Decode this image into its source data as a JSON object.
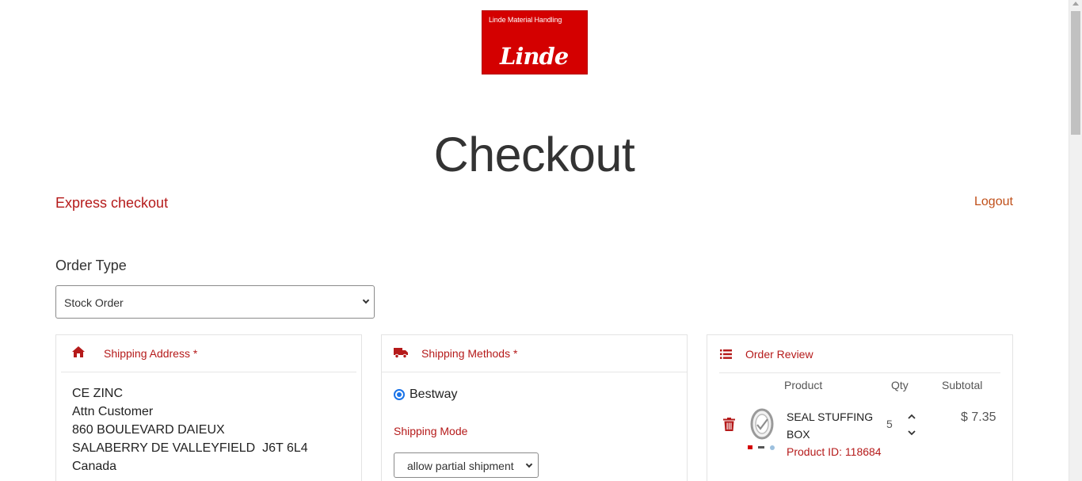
{
  "logo": {
    "top_text": "Linde Material Handling",
    "script_text": "Linde"
  },
  "page": {
    "title": "Checkout"
  },
  "nav": {
    "express_checkout": "Express checkout",
    "logout": "Logout"
  },
  "order_type": {
    "label": "Order Type",
    "selected": "Stock Order"
  },
  "shipping_address": {
    "title": "Shipping Address *",
    "lines": [
      "CE ZINC",
      "Attn Customer",
      "860 BOULEVARD DAIEUX",
      "SALABERRY DE VALLEYFIELD  J6T 6L4",
      "Canada"
    ]
  },
  "shipping_methods": {
    "title": "Shipping Methods *",
    "selected_method": "Bestway",
    "mode_label": "Shipping Mode",
    "mode_selected": "allow partial shipment"
  },
  "order_review": {
    "title": "Order Review",
    "columns": {
      "product": "Product",
      "qty": "Qty",
      "subtotal": "Subtotal"
    },
    "items": [
      {
        "name": "SEAL STUFFING BOX",
        "product_id": "Product ID: 118684",
        "qty": "5",
        "subtotal": "$ 7.35"
      }
    ]
  },
  "colors": {
    "accent": "#b51a1a",
    "logo_red": "#d40000",
    "radio_blue": "#1a73e8"
  }
}
